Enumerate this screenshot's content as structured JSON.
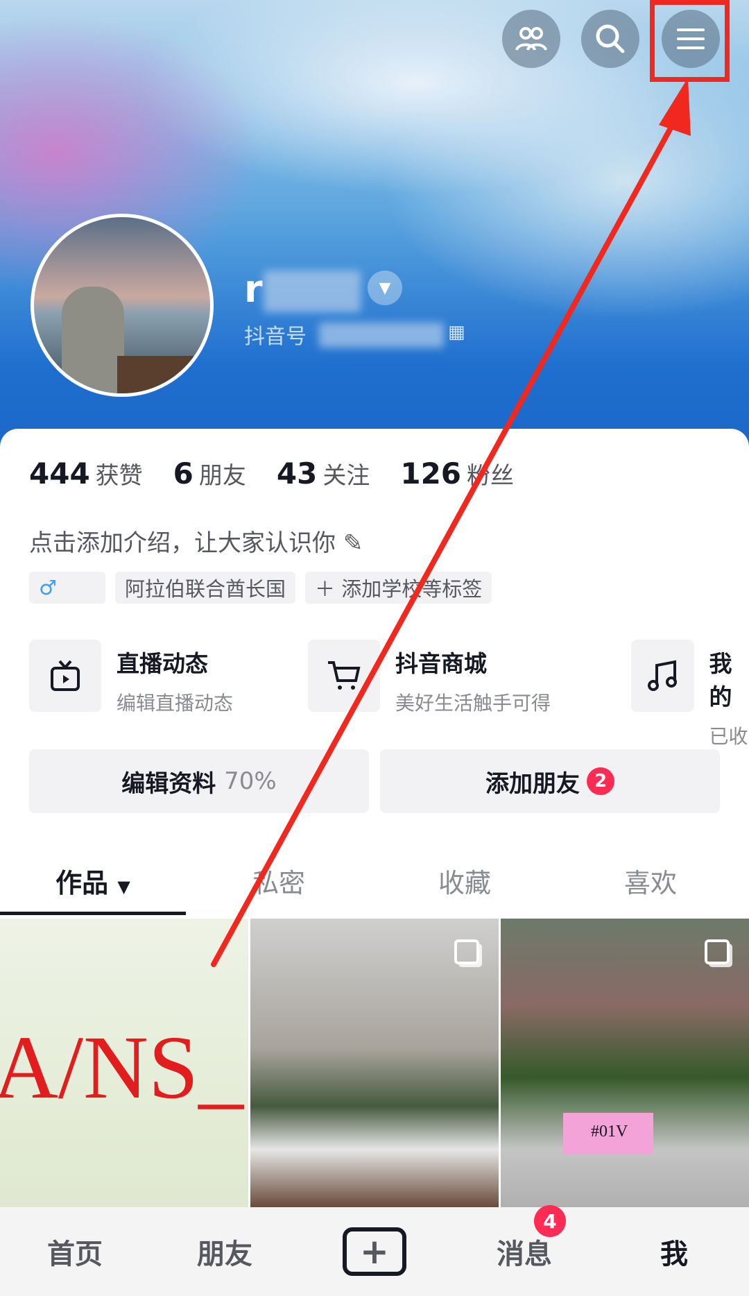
{
  "header": {
    "name_visible": "r",
    "douyin_id_label": "抖音号"
  },
  "stats": [
    {
      "value": "444",
      "label": "获赞"
    },
    {
      "value": "6",
      "label": "朋友"
    },
    {
      "value": "43",
      "label": "关注"
    },
    {
      "value": "126",
      "label": "粉丝"
    }
  ],
  "bio": "点击添加介绍，让大家认识你",
  "tags": {
    "gender": "♂",
    "location": "阿拉伯联合酋长国",
    "add": "添加学校等标签"
  },
  "features": [
    {
      "title": "直播动态",
      "subtitle": "编辑直播动态",
      "icon": "tv-icon"
    },
    {
      "title": "抖音商城",
      "subtitle": "美好生活触手可得",
      "icon": "cart-icon"
    },
    {
      "title": "我的",
      "subtitle": "已收",
      "icon": "music-icon"
    }
  ],
  "buttons": {
    "edit": "编辑资料",
    "edit_progress": "70%",
    "add_friend": "添加朋友",
    "add_friend_badge": "2"
  },
  "tabs": [
    "作品",
    "私密",
    "收藏",
    "喜欢"
  ],
  "grid": {
    "first_text": "A/NS_",
    "third_text": "#01V"
  },
  "nav": {
    "items": [
      "首页",
      "朋友",
      "我"
    ],
    "messages": "消息",
    "messages_badge": "4"
  },
  "colors": {
    "accent": "#fe2c55",
    "annotation": "#f0281e"
  }
}
